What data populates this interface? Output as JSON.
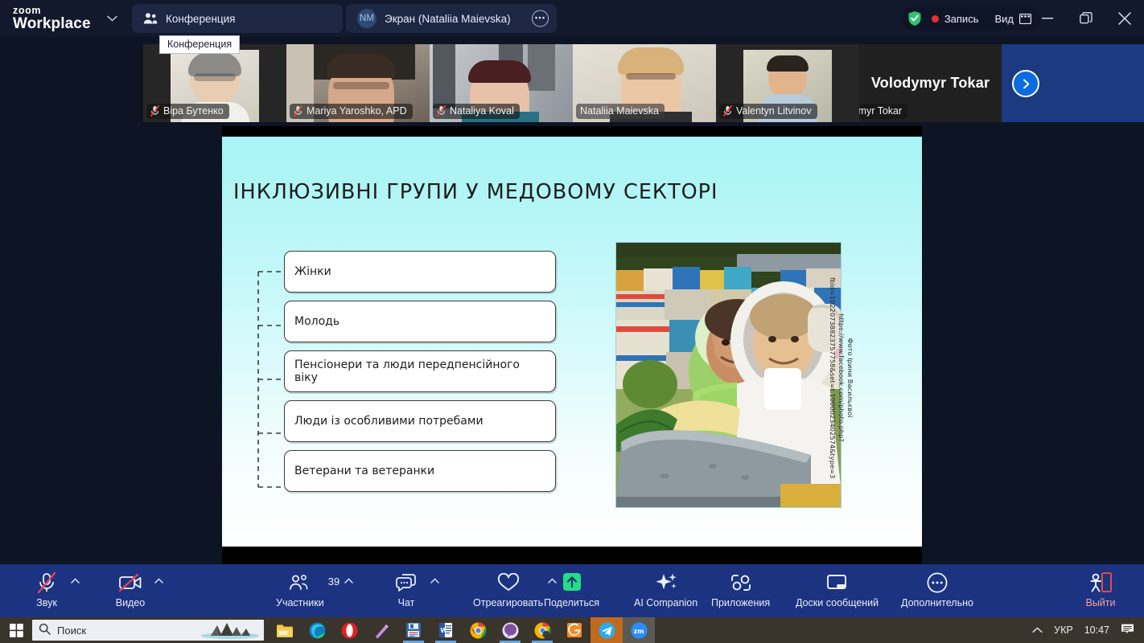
{
  "titlebar": {
    "logo_line1": "zoom",
    "logo_line2": "Workplace",
    "dropdown_icon": "chevron-down-icon",
    "meeting_tab": {
      "label": "Конференция",
      "icon": "people-icon"
    },
    "screen_tab": {
      "avatar_initials": "NM",
      "label": "Экран (Nataliia Maievska)",
      "more_icon": "more-options-icon"
    },
    "tooltip": "Конференция",
    "security_icon": "shield-check-icon",
    "recording_label": "Запись",
    "view_label": "Вид",
    "view_icon": "grid-layout-icon",
    "minimize_icon": "minimize-icon",
    "restore_icon": "restore-window-icon",
    "close_icon": "close-icon"
  },
  "video_strip": {
    "next_icon": "chevron-right-icon",
    "participants": [
      {
        "name": "Віра Бутенко",
        "muted": true,
        "active": false
      },
      {
        "name": "Mariya Yaroshko, APD",
        "muted": true,
        "active": false
      },
      {
        "name": "Nataliya Koval",
        "muted": true,
        "active": false
      },
      {
        "name": "Nataliia Maievska",
        "muted": false,
        "active": true
      },
      {
        "name": "Valentyn Litvinov",
        "muted": true,
        "active": false
      },
      {
        "name": "Volodymyr Tokar",
        "muted": true,
        "active": false,
        "display_name": "Volodymyr Tokar"
      }
    ]
  },
  "slide": {
    "title": "ІНКЛЮЗИВНІ ГРУПИ У МЕДОВОМУ СЕКТОРІ",
    "items": [
      "Жінки",
      "Молодь",
      "Пенсіонери та люди передпенсійного віку",
      "Люди із особливими потребами",
      "Ветерани та ветеранки"
    ],
    "photo_credit_line1": "Фото Ірини Васильєвої",
    "photo_credit_line2": "https://www.facebook.com/photo.php?fbi",
    "photo_credit_line3": "d=10220738823757758&set=t.100002340257",
    "photo_credit_line4": "4&type=3",
    "background_top_color": "#a8f4f6",
    "background_bottom_color": "#ffffff"
  },
  "toolbar": {
    "audio": {
      "label": "Звук",
      "icon": "microphone-muted-icon",
      "caret": "chevron-up-icon"
    },
    "video": {
      "label": "Видео",
      "icon": "camera-muted-icon",
      "caret": "chevron-up-icon"
    },
    "participants": {
      "label": "Участники",
      "icon": "participants-icon",
      "count": "39",
      "caret": "chevron-up-icon"
    },
    "chat": {
      "label": "Чат",
      "icon": "chat-bubble-icon",
      "caret": "chevron-up-icon"
    },
    "react": {
      "label": "Отреагировать",
      "icon": "heart-icon",
      "caret": "chevron-up-icon"
    },
    "share": {
      "label": "Поделиться",
      "icon": "share-screen-icon",
      "accent": "#22de86"
    },
    "companion": {
      "label": "AI Companion",
      "icon": "sparkle-icon"
    },
    "apps": {
      "label": "Приложения",
      "icon": "apps-icon"
    },
    "whiteboards": {
      "label": "Доски сообщений",
      "icon": "whiteboard-icon"
    },
    "more": {
      "label": "Дополнительно",
      "icon": "more-dots-icon"
    },
    "leave": {
      "label": "Выйти",
      "icon": "leave-door-icon",
      "accent": "#e24a4a"
    }
  },
  "taskbar": {
    "start_icon": "windows-start-icon",
    "search_placeholder": "Поиск",
    "search_icon": "search-icon",
    "apps": [
      {
        "name": "file-explorer-icon"
      },
      {
        "name": "microsoft-edge-icon"
      },
      {
        "name": "opera-icon"
      },
      {
        "name": "paint-net-icon"
      },
      {
        "name": "text-editor-icon"
      },
      {
        "name": "microsoft-word-icon"
      },
      {
        "name": "google-chrome-icon"
      },
      {
        "name": "viber-icon"
      },
      {
        "name": "chrome-canary-icon"
      },
      {
        "name": "gmail-icon"
      },
      {
        "name": "telegram-icon"
      },
      {
        "name": "zoom-icon"
      }
    ],
    "tray_caret": "chevron-up-icon",
    "language": "УКР",
    "time": "10:47",
    "notification_icon": "notifications-icon"
  }
}
